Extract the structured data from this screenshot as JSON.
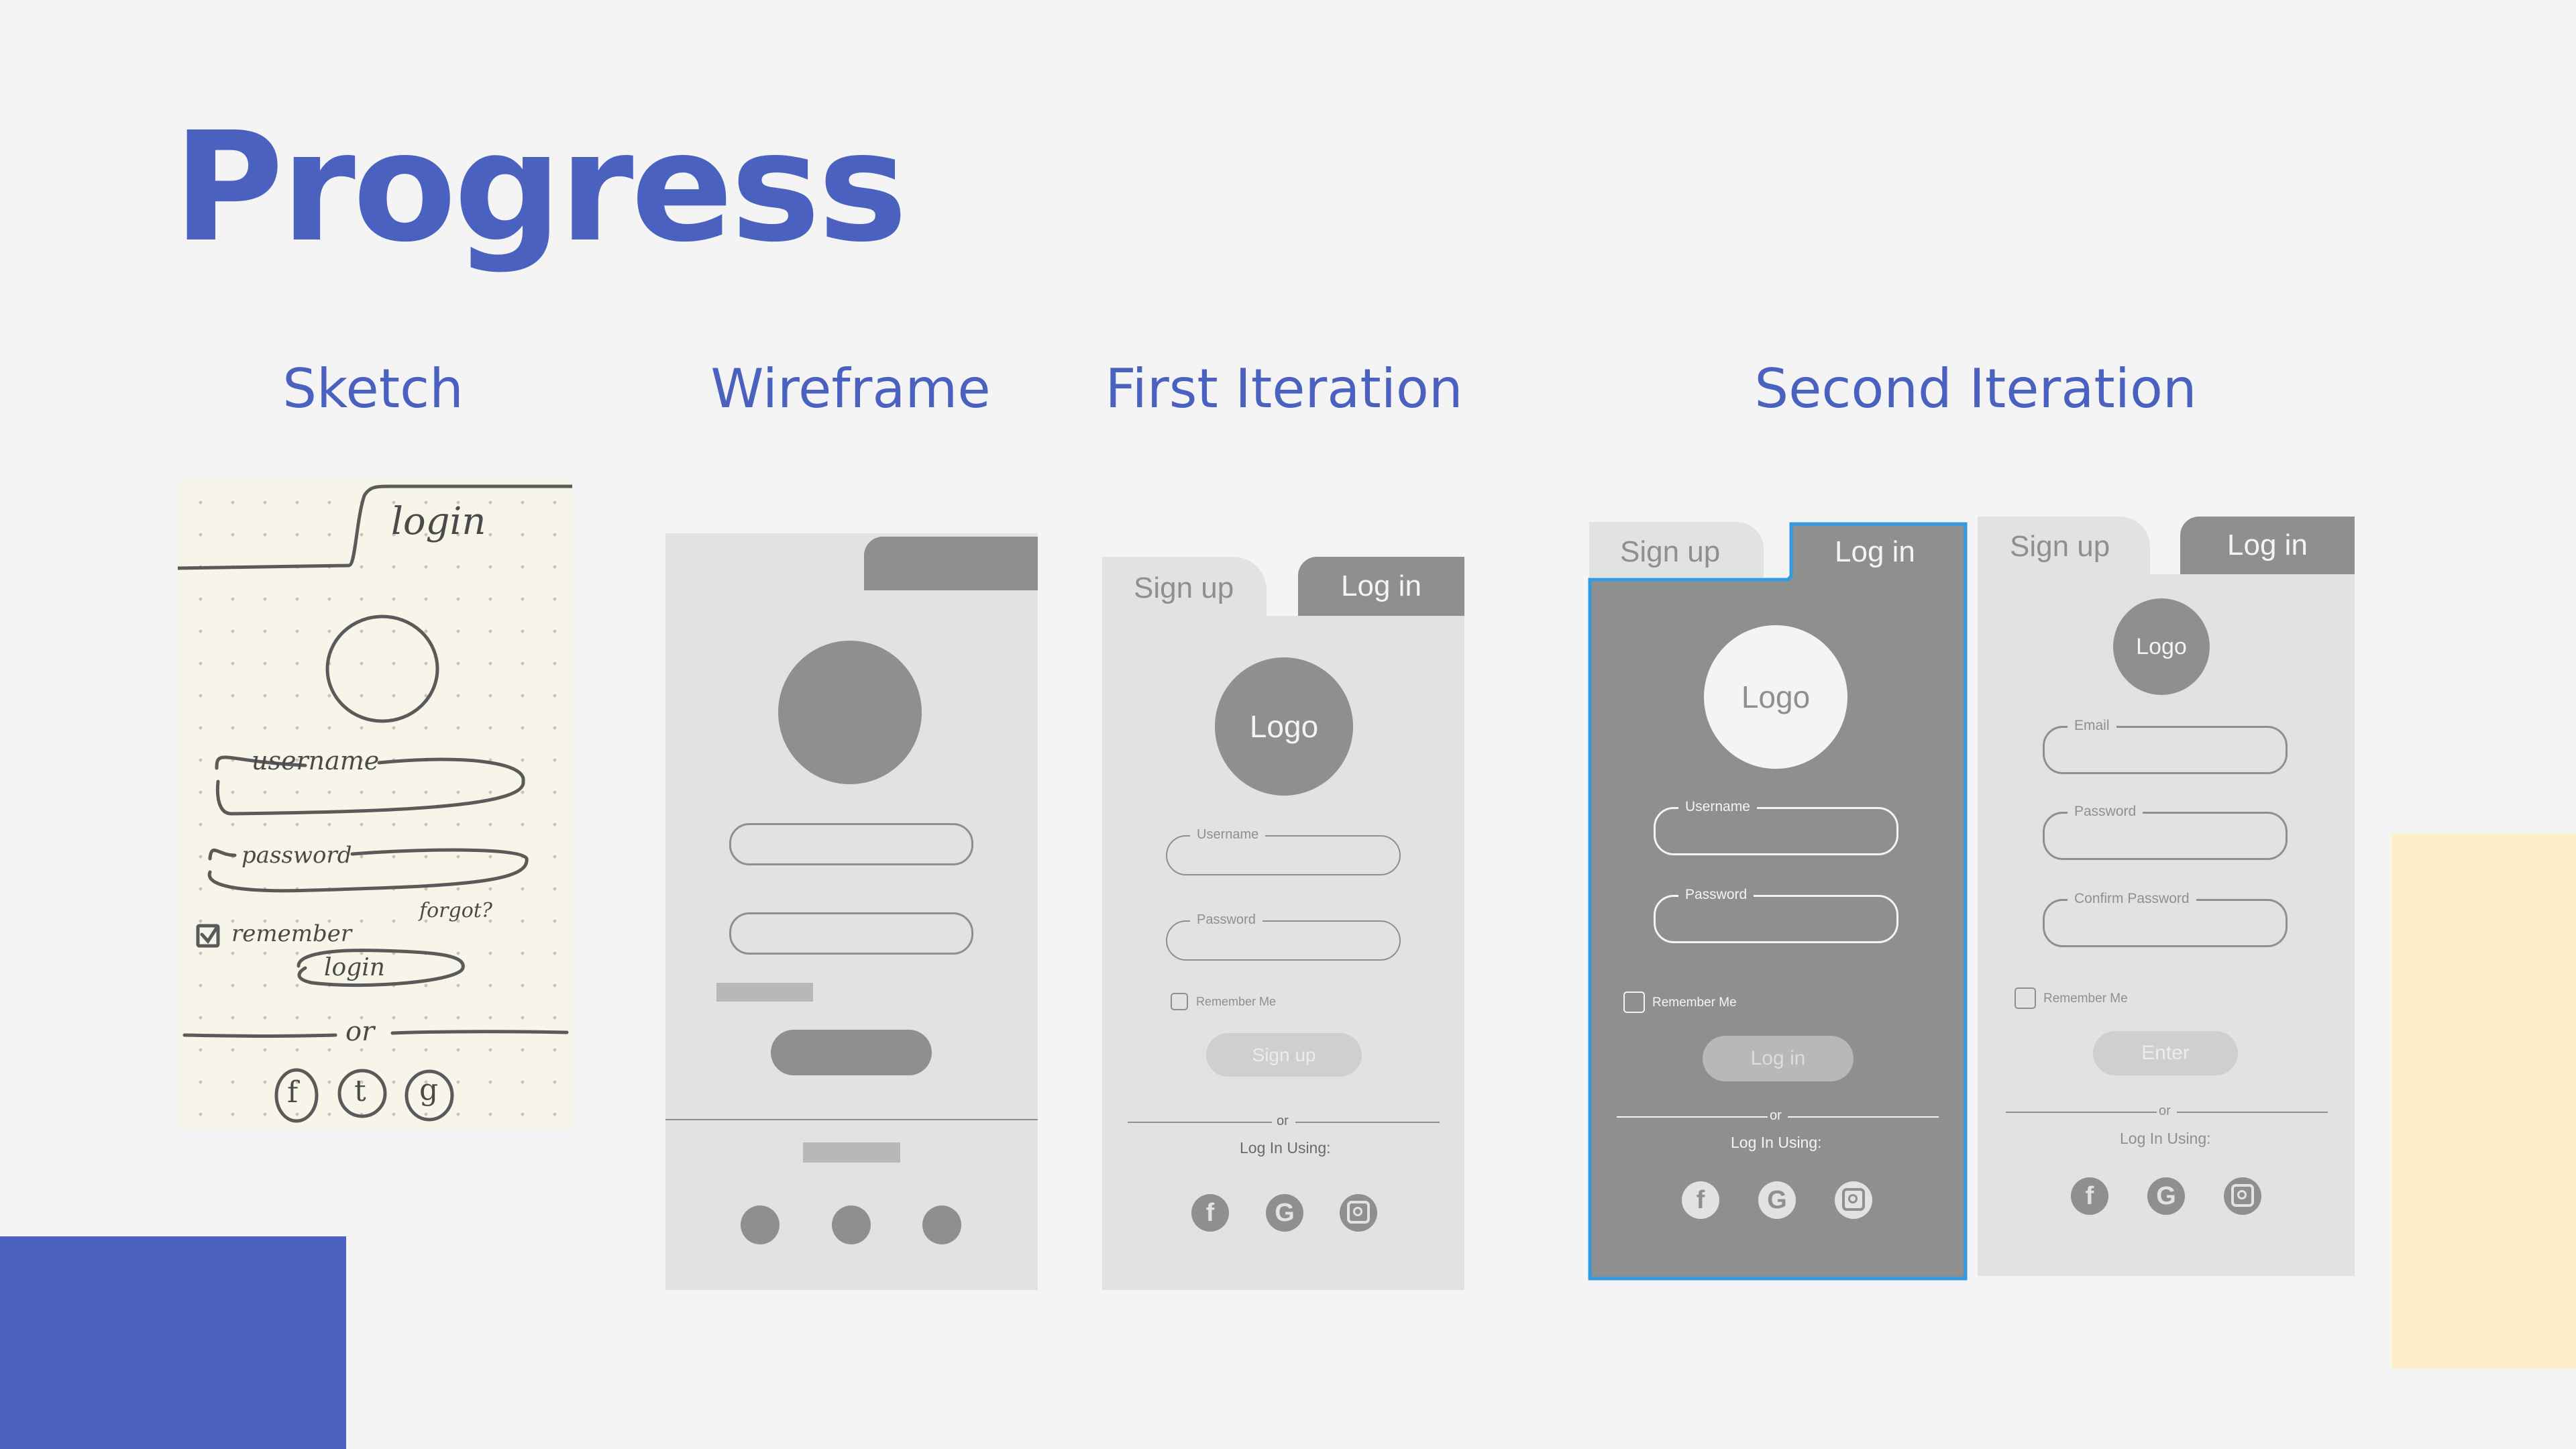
{
  "title": "Progress",
  "sections": {
    "sketch": "Sketch",
    "wireframe": "Wireframe",
    "first": "First Iteration",
    "second": "Second Iteration"
  },
  "sketch": {
    "login_tab": "login",
    "username": "username",
    "password": "password",
    "remember": "remember",
    "forgot": "forgot?",
    "login_button": "login",
    "or": "or",
    "icons": [
      "f",
      "t",
      "g"
    ]
  },
  "first_iteration": {
    "tab_signup": "Sign up",
    "tab_login": "Log in",
    "logo": "Logo",
    "username_label": "Username",
    "password_label": "Password",
    "remember": "Remember Me",
    "button": "Sign up",
    "or": "or",
    "log_in_using": "Log In Using:",
    "social_icons": [
      "facebook-icon",
      "google-icon",
      "instagram-icon"
    ]
  },
  "second_login": {
    "tab_signup": "Sign up",
    "tab_login": "Log in",
    "logo": "Logo",
    "username_label": "Username",
    "password_label": "Password",
    "remember": "Remember Me",
    "button": "Log in",
    "or": "or",
    "log_in_using": "Log In Using:"
  },
  "second_signup": {
    "tab_signup": "Sign up",
    "tab_login": "Log in",
    "logo": "Logo",
    "email_label": "Email",
    "password_label": "Password",
    "confirm_label": "Confirm Password",
    "remember": "Remember Me",
    "button": "Enter",
    "or": "or",
    "log_in_using": "Log In Using:"
  },
  "colors": {
    "accent": "#4b61bf",
    "cream": "#fcefc9",
    "panel_light": "#e2e2e2",
    "panel_dark": "#8f8f8f",
    "highlight_border": "#2e9be3"
  }
}
